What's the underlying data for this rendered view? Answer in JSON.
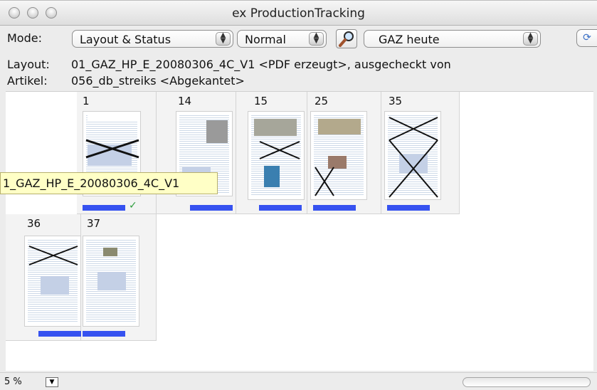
{
  "window": {
    "title": "ex ProductionTracking"
  },
  "toolbar": {
    "mode_label": "Mode:",
    "mode_value": "Layout & Status",
    "view_value": "Normal",
    "publication_value": "GAZ heute"
  },
  "info": {
    "layout_label": "Layout:",
    "layout_value": "01_GAZ_HP_E_20080306_4C_V1 <PDF erzeugt>, ausgecheckt von",
    "article_label": "Artikel:",
    "article_value": "056_db_streiks <Abgekantet>"
  },
  "pages": [
    {
      "number": "1",
      "checked": true
    },
    {
      "number": "14",
      "checked": false
    },
    {
      "number": "15",
      "checked": false
    },
    {
      "number": "25",
      "checked": false
    },
    {
      "number": "35",
      "checked": false
    },
    {
      "number": "36",
      "checked": false
    },
    {
      "number": "37",
      "checked": false
    }
  ],
  "tooltip": {
    "text": "1_GAZ_HP_E_20080306_4C_V1"
  },
  "status": {
    "zoom": "5 %",
    "checkmark": "✓"
  },
  "colors": {
    "status_bar": "#3652f0",
    "check": "#2e9e3e",
    "tooltip_bg": "#ffffc6"
  },
  "icons": {
    "search": "magnifier-icon",
    "refresh": "refresh-icon"
  }
}
